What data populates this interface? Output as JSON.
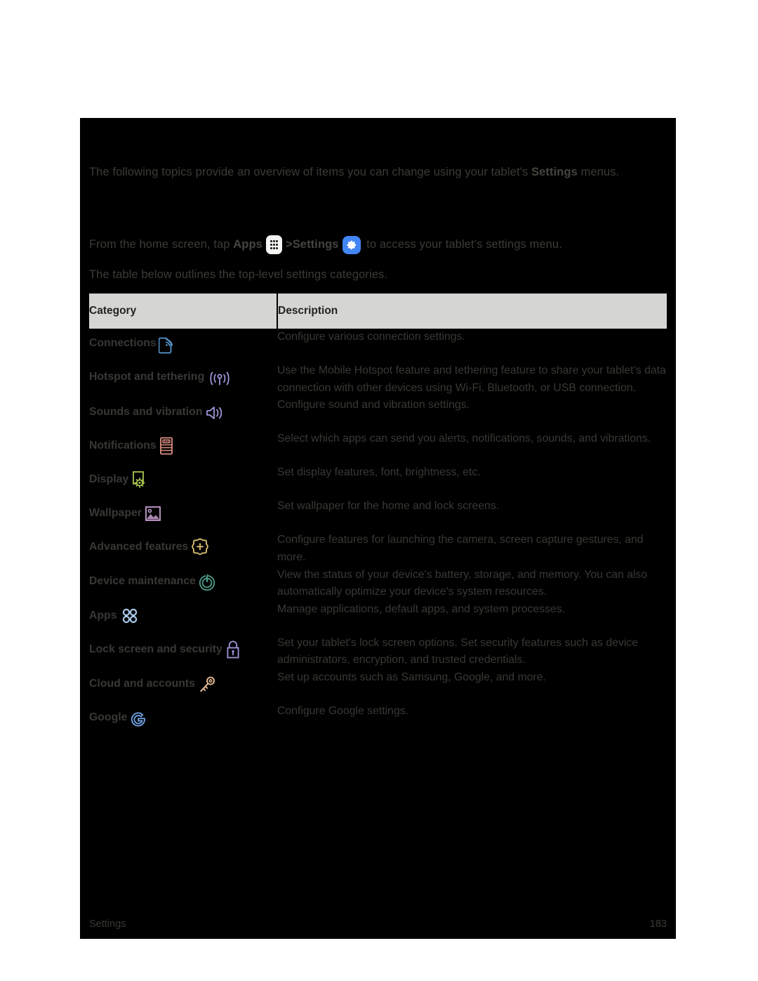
{
  "page": {
    "background": "#000000",
    "page_background": "#ffffff"
  },
  "intro": {
    "line1_a": "The following topics provide an overview of items you can change using your tablet’s ",
    "line1_bold": "Settings",
    "line1_b": " menus.",
    "line2_a": "From the home screen, tap ",
    "line2_apps": "Apps",
    "line2_sep": " > ",
    "line2_settings": "Settings",
    "line2_b": " to access your tablet’s settings menu.",
    "line3": "The table below outlines the top-level settings categories."
  },
  "table": {
    "header_bg": "#d5d5d3",
    "columns": [
      "Category",
      "Description"
    ],
    "rows": [
      {
        "category": "Connections",
        "icon": "connections-icon",
        "icon_color": "#5b9bd5",
        "description": "Configure various connection settings."
      },
      {
        "category": "Hotspot and tethering",
        "icon": "hotspot-icon",
        "icon_color": "#9d97d8",
        "description": "Use the Mobile Hotspot feature and tethering feature to share your tablet’s data connection with other devices using Wi-Fi, Bluetooth, or USB connection."
      },
      {
        "category": "Sounds and vibration",
        "icon": "speaker-icon",
        "icon_color": "#9d97d8",
        "description": "Configure sound and vibration settings."
      },
      {
        "category": "Notifications",
        "icon": "notifications-icon",
        "icon_color": "#dd8f82",
        "description": "Select which apps can send you alerts, notifications, sounds, and vibrations."
      },
      {
        "category": "Display",
        "icon": "display-icon",
        "icon_color": "#a8c64f",
        "description": "Set display features, font, brightness, etc."
      },
      {
        "category": "Wallpaper",
        "icon": "wallpaper-icon",
        "icon_color": "#c79ed0",
        "description": "Set wallpaper for the home and lock screens."
      },
      {
        "category": "Advanced features",
        "icon": "advanced-features-icon",
        "icon_color": "#d8bb6a",
        "description": "Configure features for launching the camera, screen capture gestures, and more."
      },
      {
        "category": "Device maintenance",
        "icon": "device-maintenance-icon",
        "icon_color": "#4f9d8e",
        "description": "View the status of your device's battery, storage, and memory. You can also automatically optimize your device's system resources."
      },
      {
        "category": "Apps",
        "icon": "apps-dots-icon",
        "icon_color": "#a9c9e8",
        "description": "Manage applications, default apps, and system processes."
      },
      {
        "category": "Lock screen and security",
        "icon": "lock-icon",
        "icon_color": "#9a8fd0",
        "description": "Set your tablet's lock screen options. Set security features such as device administrators, encryption, and trusted credentials."
      },
      {
        "category": "Cloud and accounts",
        "icon": "key-icon",
        "icon_color": "#e7bb96",
        "description": "Set up accounts such as Samsung, Google, and more."
      },
      {
        "category": "Google",
        "icon": "google-g-icon",
        "icon_color": "#6f9ede",
        "description": "Configure Google settings."
      }
    ]
  },
  "footer": {
    "section": "Settings",
    "page_number": "183"
  }
}
